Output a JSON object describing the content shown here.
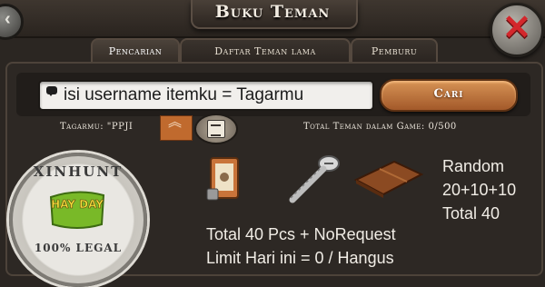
{
  "header": {
    "title": "Buku Teman"
  },
  "tabs": [
    {
      "label": "Pencarian"
    },
    {
      "label": "Daftar Teman lama"
    },
    {
      "label": "Pemburu"
    }
  ],
  "search": {
    "value": "isi username itemku = Tagarmu",
    "button_label": "Cari"
  },
  "tag_label": "Tagarmu: \"PPJI",
  "friends_count": "Total Teman dalam Game: 0/500",
  "stamp": {
    "top_text": "XINHUNT",
    "logo_text": "HAY DAY",
    "bottom_text": "100% LEGAL"
  },
  "offer": {
    "random_line1": "Random",
    "random_line2": "20+10+10",
    "random_line3": "Total 40",
    "total_line": "Total 40 Pcs + NoRequest",
    "limit_line": "Limit Hari ini = 0 / Hangus"
  },
  "colors": {
    "accent": "#c06a2e",
    "close": "#d3272c",
    "button": "#b8692f"
  },
  "icons": [
    "back-icon",
    "close-icon",
    "chat-icon",
    "arrow-up-icon",
    "notes-icon"
  ]
}
